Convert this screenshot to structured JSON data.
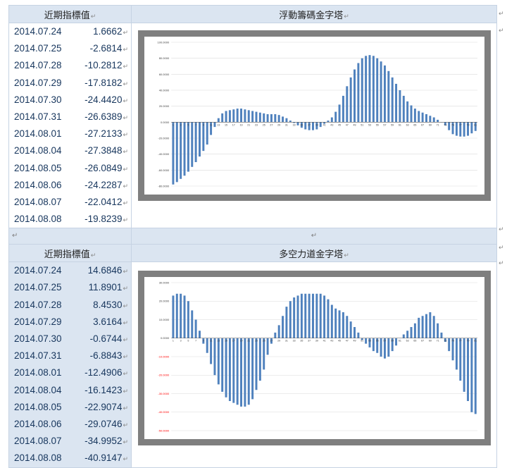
{
  "section1": {
    "left_header": "近期指標值",
    "right_header": "浮動籌碼金字塔",
    "rows": [
      {
        "date": "2014.07.24",
        "value": "1.6662"
      },
      {
        "date": "2014.07.25",
        "value": "-2.6814"
      },
      {
        "date": "2014.07.28",
        "value": "-10.2812"
      },
      {
        "date": "2014.07.29",
        "value": "-17.8182"
      },
      {
        "date": "2014.07.30",
        "value": "-24.4420"
      },
      {
        "date": "2014.07.31",
        "value": "-26.6389"
      },
      {
        "date": "2014.08.01",
        "value": "-27.2133"
      },
      {
        "date": "2014.08.04",
        "value": "-27.3848"
      },
      {
        "date": "2014.08.05",
        "value": "-26.0849"
      },
      {
        "date": "2014.08.06",
        "value": "-24.2287"
      },
      {
        "date": "2014.08.07",
        "value": "-22.0412"
      },
      {
        "date": "2014.08.08",
        "value": "-19.8239"
      }
    ]
  },
  "section2": {
    "left_header": "近期指標值",
    "right_header": "多空力道金字塔",
    "rows": [
      {
        "date": "2014.07.24",
        "value": "14.6846"
      },
      {
        "date": "2014.07.25",
        "value": "11.8901"
      },
      {
        "date": "2014.07.28",
        "value": "8.4530"
      },
      {
        "date": "2014.07.29",
        "value": "3.6164"
      },
      {
        "date": "2014.07.30",
        "value": "-0.6744"
      },
      {
        "date": "2014.07.31",
        "value": "-6.8843"
      },
      {
        "date": "2014.08.01",
        "value": "-12.4906"
      },
      {
        "date": "2014.08.04",
        "value": "-16.1423"
      },
      {
        "date": "2014.08.05",
        "value": "-22.9074"
      },
      {
        "date": "2014.08.06",
        "value": "-29.0746"
      },
      {
        "date": "2014.08.07",
        "value": "-34.9952"
      },
      {
        "date": "2014.08.08",
        "value": "-40.9147"
      }
    ]
  },
  "markers": {
    "paragraph": "↵"
  },
  "colors": {
    "bar": "#4f81bd",
    "grid": "#d9d9d9",
    "frame": "#7f7f7f",
    "header_bg": "#dbe5f1",
    "value_text": "#17365d",
    "negative_tick": "#ff0000"
  },
  "chart_data": [
    {
      "type": "bar",
      "ylim": [
        -80,
        100
      ],
      "yticks": [
        "100.0000",
        "80.0000",
        "60.0000",
        "40.0000",
        "20.0000",
        "0.0000",
        "-20.0000",
        "-40.0000",
        "-60.0000",
        "-80.0000"
      ],
      "ytick_values": [
        100,
        80,
        60,
        40,
        20,
        0,
        -20,
        -40,
        -60,
        -80
      ],
      "xticks_shown": "odd (1, 3, 5, ... 81)",
      "values": [
        -78,
        -75,
        -71,
        -67,
        -62,
        -56,
        -50,
        -43,
        -36,
        -28,
        -16,
        -6,
        5,
        11,
        14,
        15,
        16,
        17,
        17,
        16,
        15,
        14,
        13,
        12,
        11,
        10,
        10,
        10,
        9,
        7,
        5,
        2,
        -1,
        -4,
        -7,
        -9,
        -10,
        -10,
        -9,
        -6,
        -2,
        2,
        6,
        13,
        22,
        33,
        45,
        56,
        66,
        74,
        80,
        83,
        84,
        83,
        80,
        76,
        71,
        64,
        56,
        48,
        40,
        33,
        26,
        21,
        17,
        14,
        12,
        10,
        8,
        6,
        3,
        0,
        -4,
        -10,
        -15,
        -17,
        -18,
        -18,
        -17,
        -14,
        -11
      ]
    },
    {
      "type": "bar",
      "ylim": [
        -50,
        30
      ],
      "yticks": [
        "30.0000",
        "20.0000",
        "10.0000",
        "0.0000",
        "-10.0000",
        "-20.0000",
        "-30.0000",
        "-40.0000",
        "-50.0000"
      ],
      "ytick_values": [
        30,
        20,
        10,
        0,
        -10,
        -20,
        -30,
        -40,
        -50
      ],
      "xticks_shown": "odd (1, 3, 5, ... 81)",
      "values": [
        23,
        24,
        24,
        23,
        20,
        15,
        10,
        4,
        -3,
        -8,
        -14,
        -20,
        -25,
        -29,
        -32,
        -34,
        -35,
        -36,
        -37,
        -37,
        -36,
        -33,
        -28,
        -23,
        -17,
        -9,
        -3,
        3,
        7,
        12,
        17,
        20,
        22,
        23,
        24,
        24,
        24,
        24,
        24,
        24,
        23,
        21,
        18,
        16,
        15,
        14,
        12,
        9,
        6,
        3,
        -1,
        -3,
        -5,
        -7,
        -8,
        -10,
        -11,
        -10,
        -7,
        -4,
        0,
        2,
        4,
        6,
        8,
        11,
        12,
        13,
        14,
        12,
        8,
        3,
        -2,
        -7,
        -12,
        -17,
        -23,
        -29,
        -34,
        -40,
        -41
      ]
    }
  ]
}
